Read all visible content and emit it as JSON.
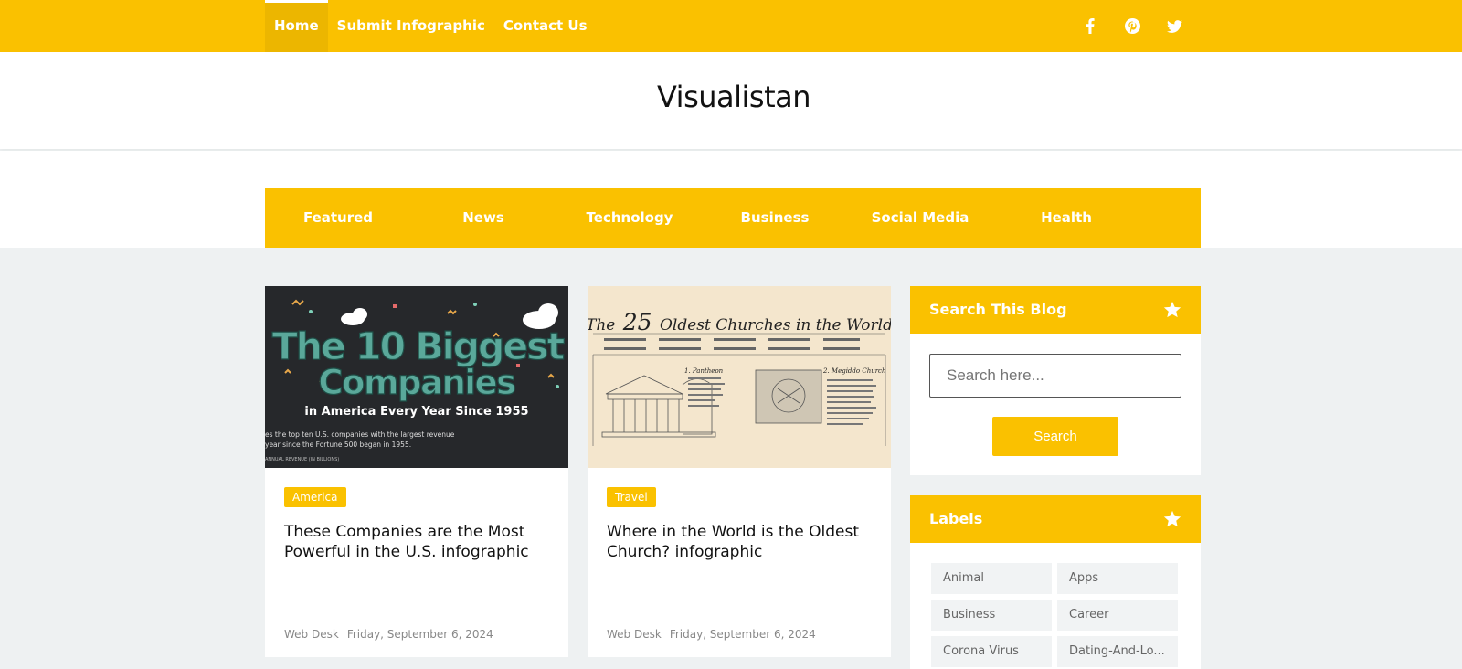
{
  "topnav": {
    "items": [
      {
        "label": "Home",
        "active": true
      },
      {
        "label": "Submit Infographic"
      },
      {
        "label": "Contact Us"
      }
    ],
    "social_icons": [
      "facebook-icon",
      "pinterest-icon",
      "twitter-icon"
    ]
  },
  "site": {
    "title": "Visualistan"
  },
  "categories": [
    "Featured",
    "News",
    "Technology",
    "Business",
    "Social Media",
    "Health"
  ],
  "posts": [
    {
      "thumb": {
        "line1": "The 10 Biggest",
        "line2": "Companies",
        "line3": "in America Every Year Since 1955",
        "caption1": "es the top ten U.S. companies with the largest revenue",
        "caption2": "year since the Fortune 500 began in 1955.",
        "caption3": "ANNUAL REVENUE (IN BILLIONS)"
      },
      "tag": "America",
      "title": "These Companies are the Most Powerful in the U.S. infographic",
      "author": "Web Desk",
      "date": "Friday, September 6, 2024"
    },
    {
      "thumb": {
        "title_pre": "The",
        "title_num": "25",
        "title_post": "Oldest Churches in the World",
        "item1": "1. Pantheon",
        "item2": "2. Megiddo Church"
      },
      "tag": "Travel",
      "title": "Where in the World is the Oldest Church? infographic",
      "author": "Web Desk",
      "date": "Friday, September 6, 2024"
    }
  ],
  "search_widget": {
    "title": "Search This Blog",
    "placeholder": "Search here...",
    "button": "Search"
  },
  "labels_widget": {
    "title": "Labels",
    "items": [
      "Animal",
      "Apps",
      "Business",
      "Career",
      "Corona Virus",
      "Dating-And-Lo..."
    ]
  },
  "colors": {
    "accent": "#fac100",
    "background": "#eef1f2"
  }
}
